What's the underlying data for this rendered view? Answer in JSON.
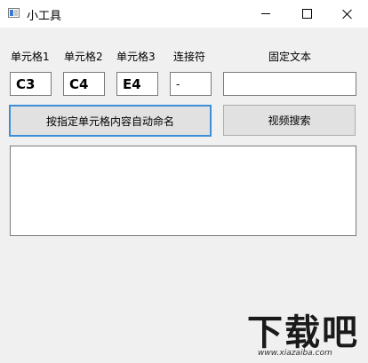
{
  "window": {
    "title": "小工具"
  },
  "labels": {
    "cell1": "单元格1",
    "cell2": "单元格2",
    "cell3": "单元格3",
    "connector": "连接符",
    "fixed_text": "固定文本"
  },
  "fields": {
    "cell1_value": "C3",
    "cell2_value": "C4",
    "cell3_value": "E4",
    "connector_value": "-",
    "fixed_text_value": ""
  },
  "buttons": {
    "auto_name_label": "按指定单元格内容自动命名",
    "video_search_label": "视频搜索"
  },
  "output": {
    "value": ""
  },
  "watermark": {
    "text": "下载吧",
    "url": "www.xiazaiba.com"
  },
  "colors": {
    "window_bg": "#f0f0f0",
    "primary_focus_border": "#3c8fd6"
  }
}
